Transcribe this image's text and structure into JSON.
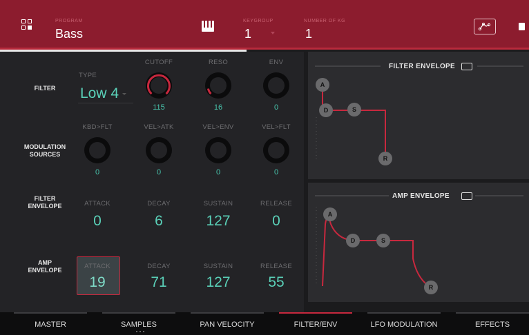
{
  "header": {
    "program_label": "PROGRAM",
    "program_value": "Bass",
    "keygroup_label": "KEYGROUP",
    "keygroup_value": "1",
    "number_label": "NUMBER OF KG",
    "number_value": "1"
  },
  "rows": {
    "filter": "FILTER",
    "modulation": [
      "MODULATION",
      "SOURCES"
    ],
    "filter_envelope": [
      "FILTER",
      "ENVELOPE"
    ],
    "amp_envelope": [
      "AMP",
      "ENVELOPE"
    ]
  },
  "filter": {
    "type_label": "TYPE",
    "type_value": "Low 4",
    "cutoff_label": "CUTOFF",
    "cutoff_value": "115",
    "reso_label": "RESO",
    "reso_value": "16",
    "env_label": "ENV",
    "env_value": "0"
  },
  "modulation": {
    "kbd_label": "KBD>FLT",
    "kbd_value": "0",
    "velatk_label": "VEL>ATK",
    "velatk_value": "0",
    "velenv_label": "VEL>ENV",
    "velenv_value": "0",
    "velflt_label": "VEL>FLT",
    "velflt_value": "0"
  },
  "filter_env": {
    "attack_label": "ATTACK",
    "attack_value": "0",
    "decay_label": "DECAY",
    "decay_value": "6",
    "sustain_label": "SUSTAIN",
    "sustain_value": "127",
    "release_label": "RELEASE",
    "release_value": "0"
  },
  "amp_env": {
    "attack_label": "ATTACK",
    "attack_value": "19",
    "decay_label": "DECAY",
    "decay_value": "71",
    "sustain_label": "SUSTAIN",
    "sustain_value": "127",
    "release_label": "RELEASE",
    "release_value": "55"
  },
  "graphs": {
    "filter_title": "FILTER ENVELOPE",
    "amp_title": "AMP ENVELOPE",
    "nodes": {
      "a": "A",
      "d": "D",
      "s": "S",
      "r": "R"
    }
  },
  "tabs": [
    "MASTER",
    "SAMPLES",
    "PAN VELOCITY",
    "FILTER/ENV",
    "LFO MODULATION",
    "EFFECTS"
  ],
  "active_tab": "FILTER/ENV",
  "colors": {
    "accent_red": "#c8283e",
    "header_bg": "#8c1c2e",
    "value_teal": "#5ad0b8",
    "curve_red": "#c8283e"
  },
  "icons": {
    "program_browser": "grid-icon",
    "keyboard": "piano-icon",
    "envelope_view": "envelope-curve-icon",
    "menu": "chip-icon",
    "fullscreen": "fullscreen-icon"
  }
}
